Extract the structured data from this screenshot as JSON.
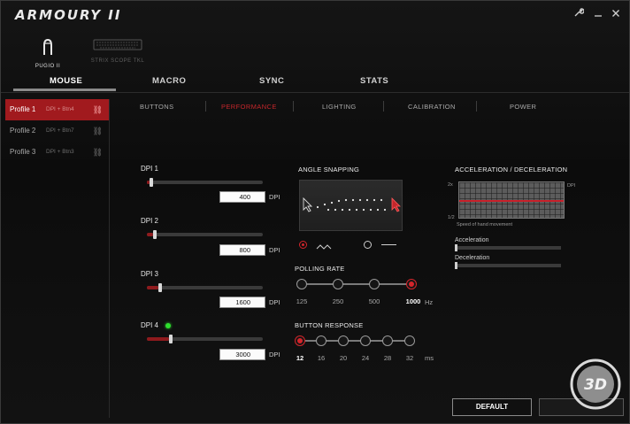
{
  "app": {
    "title": "ARMOURY II"
  },
  "window_controls": {
    "settings_icon": "wrench-icon",
    "minimize_icon": "minimize-icon",
    "close_icon": "close-icon"
  },
  "devices": [
    {
      "name": "PUGIO II",
      "icon": "mouse-icon",
      "active": true
    },
    {
      "name": "STRIX SCOPE TKL",
      "icon": "keyboard-icon",
      "active": false
    }
  ],
  "main_tabs": [
    "MOUSE",
    "MACRO",
    "SYNC",
    "STATS"
  ],
  "active_main_tab": "MOUSE",
  "profiles": [
    {
      "name": "Profile 1",
      "binding": "DPI + Btn4",
      "active": true
    },
    {
      "name": "Profile 2",
      "binding": "DPI + Btn7",
      "active": false
    },
    {
      "name": "Profile 3",
      "binding": "DPI + Btn3",
      "active": false
    }
  ],
  "sub_tabs": [
    "BUTTONS",
    "PERFORMANCE",
    "LIGHTING",
    "CALIBRATION",
    "POWER"
  ],
  "active_sub_tab": "PERFORMANCE",
  "dpi": {
    "unit": "DPI",
    "stages": [
      {
        "label": "DPI 1",
        "value": "400",
        "level": 0.02,
        "active": false
      },
      {
        "label": "DPI 2",
        "value": "800",
        "level": 0.05,
        "active": false
      },
      {
        "label": "DPI 3",
        "value": "1600",
        "level": 0.1,
        "active": false
      },
      {
        "label": "DPI 4",
        "value": "3000",
        "level": 0.19,
        "active": true
      }
    ]
  },
  "angle_snapping": {
    "title": "ANGLE SNAPPING",
    "enabled": true
  },
  "polling_rate": {
    "title": "POLLING RATE",
    "options": [
      "125",
      "250",
      "500",
      "1000"
    ],
    "selected": "1000",
    "unit": "Hz"
  },
  "button_response": {
    "title": "BUTTON RESPONSE",
    "options": [
      "12",
      "16",
      "20",
      "24",
      "28",
      "32"
    ],
    "selected": "12",
    "unit": "ms"
  },
  "acceleration": {
    "title": "ACCELERATION / DECELERATION",
    "y_top": "2x",
    "y_bottom": "1/2",
    "y_unit": "DPI",
    "caption": "Speed of hand movement",
    "accel_label": "Acceleration",
    "accel_level": 0,
    "decel_label": "Deceleration",
    "decel_level": 0
  },
  "buttons": {
    "default": "DEFAULT",
    "apply": ""
  },
  "colors": {
    "accent": "#c4262b",
    "active_profile": "#a11a1e",
    "dpi_indicator": "#2ee02e"
  }
}
